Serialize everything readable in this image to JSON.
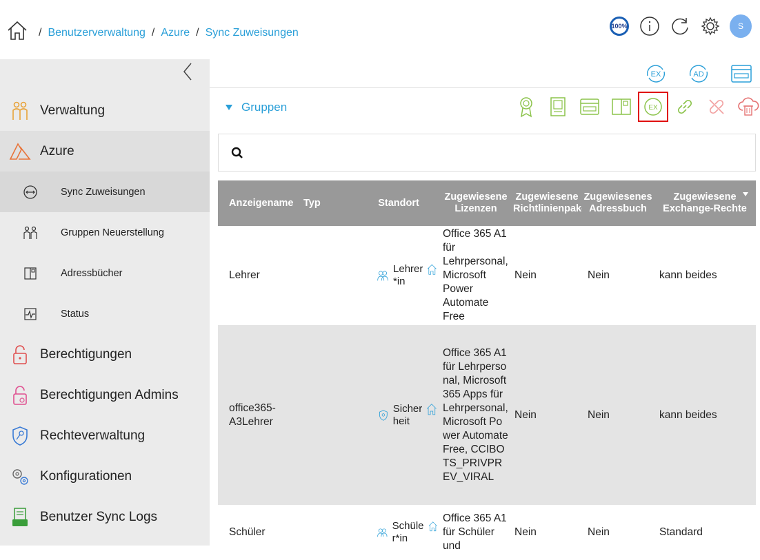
{
  "breadcrumb": {
    "sep": "/",
    "items": [
      "Benutzerverwaltung",
      "Azure",
      "Sync Zuweisungen"
    ]
  },
  "header": {
    "zoom": "100%",
    "avatar_initial": "S"
  },
  "sidebar": {
    "items": [
      {
        "label": "Verwaltung"
      },
      {
        "label": "Azure"
      },
      {
        "label": "Sync Zuweisungen"
      },
      {
        "label": "Gruppen Neuerstellung"
      },
      {
        "label": "Adressbücher"
      },
      {
        "label": "Status"
      },
      {
        "label": "Berechtigungen"
      },
      {
        "label": "Berechtigungen Admins"
      },
      {
        "label": "Rechteverwaltung"
      },
      {
        "label": "Konfigurationen"
      },
      {
        "label": "Benutzer Sync Logs"
      }
    ]
  },
  "toolbar": {
    "ex_label": "EX",
    "ad_label": "AD"
  },
  "section": {
    "title": "Gruppen",
    "ex_action_label": "EX"
  },
  "search": {
    "placeholder": ""
  },
  "table": {
    "columns": [
      "Anzeigename",
      "Typ",
      "Standort",
      "Zugewiesene Lizenzen",
      "Zugewiesene Richtlinienpaket",
      "Zugewiesenes Adressbuch",
      "Zugewiesene Exchange-Rechte"
    ],
    "rows": [
      {
        "name": "Lehrer",
        "type": "Lehrer *in",
        "licenses": "Office 365 A1 für Lehrpersonal, Microsoft Power Automate Free",
        "policy": "Nein",
        "addressbook": "Nein",
        "exchange": "kann beides"
      },
      {
        "name": "office365-A3Lehrer",
        "type": "Sicher heit",
        "licenses": "Office 365 A1 für Lehrpersonal, Microsoft 365 Apps für Lehrpersonal, Microsoft Power Automate Free, CCIBOTS_PRIVPREV_VIRAL",
        "policy": "Nein",
        "addressbook": "Nein",
        "exchange": "kann beides"
      },
      {
        "name": "Schüler",
        "type": "Schüle r*in",
        "licenses": "Office 365 A1 für Schüler und",
        "policy": "Nein",
        "addressbook": "Nein",
        "exchange": "Standard"
      }
    ]
  },
  "colors": {
    "accent": "#2a9fd8",
    "header_bg": "#999999",
    "sidebar_bg": "#ebebeb",
    "action_green": "#8bc34a",
    "action_red": "#e57373",
    "highlight": "#e01010"
  }
}
